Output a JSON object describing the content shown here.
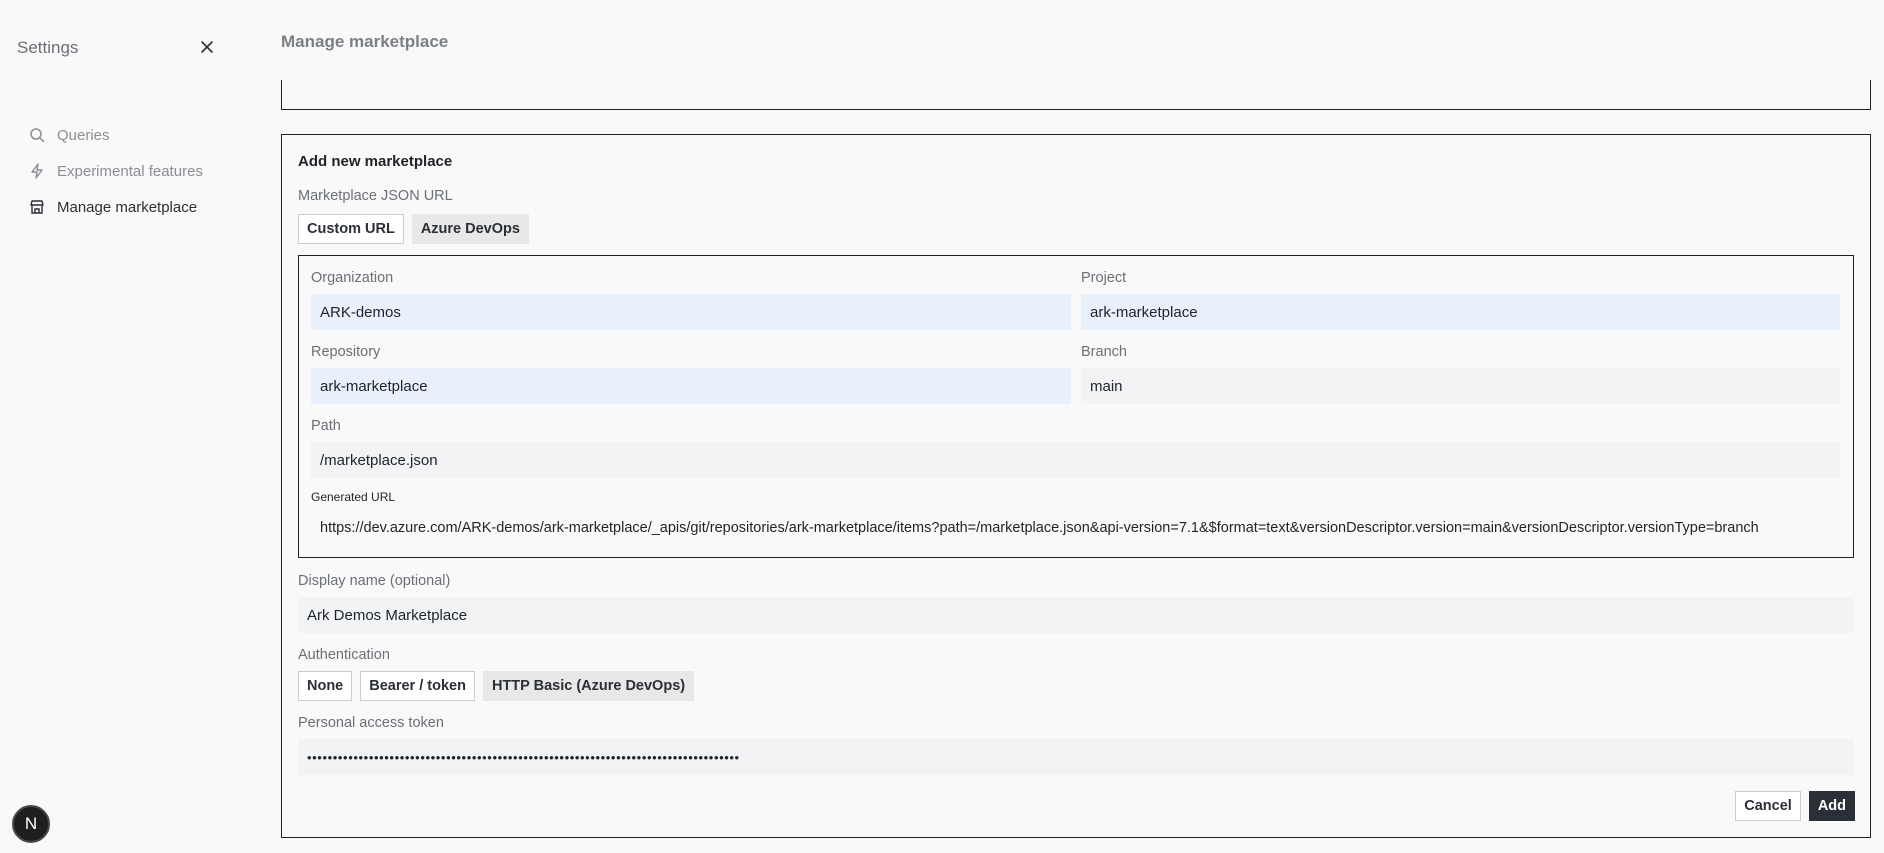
{
  "sidebar": {
    "title": "Settings",
    "items": [
      {
        "label": "Queries",
        "icon": "search-icon"
      },
      {
        "label": "Experimental features",
        "icon": "lightning-icon"
      },
      {
        "label": "Manage marketplace",
        "icon": "store-icon"
      }
    ],
    "avatar": "N"
  },
  "main": {
    "title": "Manage marketplace",
    "card": {
      "title": "Add new marketplace",
      "json_url_label": "Marketplace JSON URL",
      "source_options": [
        "Custom URL",
        "Azure DevOps"
      ],
      "source_selected": "Azure DevOps",
      "azure": {
        "organization_label": "Organization",
        "organization_value": "ARK-demos",
        "project_label": "Project",
        "project_value": "ark-marketplace",
        "repository_label": "Repository",
        "repository_value": "ark-marketplace",
        "branch_label": "Branch",
        "branch_value": "main",
        "path_label": "Path",
        "path_value": "/marketplace.json",
        "generated_label": "Generated URL",
        "generated_url": "https://dev.azure.com/ARK-demos/ark-marketplace/_apis/git/repositories/ark-marketplace/items?path=/marketplace.json&api-version=7.1&$format=text&versionDescriptor.version=main&versionDescriptor.versionType=branch"
      },
      "display_name_label": "Display name (optional)",
      "display_name_value": "Ark Demos Marketplace",
      "auth_label": "Authentication",
      "auth_options": [
        "None",
        "Bearer / token",
        "HTTP Basic (Azure DevOps)"
      ],
      "auth_selected": "HTTP Basic (Azure DevOps)",
      "token_label": "Personal access token",
      "token_value": "••••••••••••••••••••••••••••••••••••••••••••••••••••••••••••••••••••••••••••••••••••",
      "cancel_label": "Cancel",
      "add_label": "Add"
    }
  }
}
